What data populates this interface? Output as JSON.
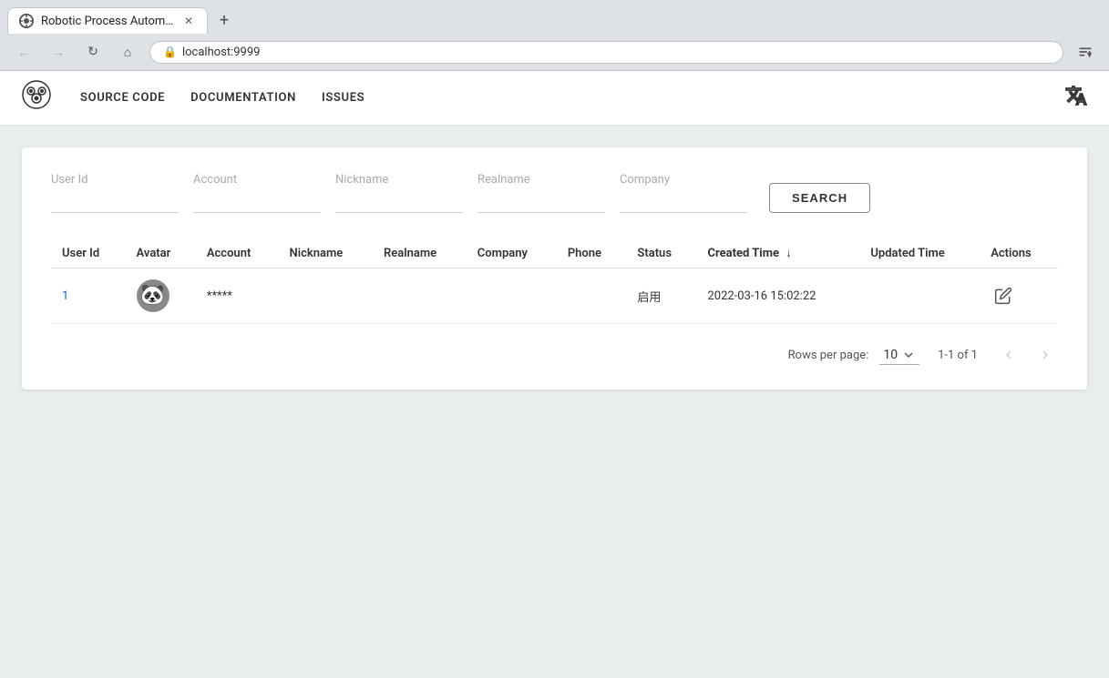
{
  "browser": {
    "tab_title": "Robotic Process Automation T",
    "tab_favicon": "🐙",
    "url": "localhost:9999",
    "new_tab_label": "+"
  },
  "header": {
    "logo": "🤖",
    "nav": [
      {
        "id": "source-code",
        "label": "SOURCE CODE"
      },
      {
        "id": "documentation",
        "label": "DOCUMENTATION"
      },
      {
        "id": "issues",
        "label": "ISSUES"
      }
    ],
    "translate_icon": "translate"
  },
  "search": {
    "fields": [
      {
        "id": "user-id",
        "label": "User Id",
        "placeholder": ""
      },
      {
        "id": "account",
        "label": "Account",
        "placeholder": ""
      },
      {
        "id": "nickname",
        "label": "Nickname",
        "placeholder": ""
      },
      {
        "id": "realname",
        "label": "Realname",
        "placeholder": ""
      },
      {
        "id": "company",
        "label": "Company",
        "placeholder": ""
      }
    ],
    "button_label": "SEARCH"
  },
  "table": {
    "columns": [
      {
        "id": "user-id",
        "label": "User Id",
        "sortable": false
      },
      {
        "id": "avatar",
        "label": "Avatar",
        "sortable": false
      },
      {
        "id": "account",
        "label": "Account",
        "sortable": false
      },
      {
        "id": "nickname",
        "label": "Nickname",
        "sortable": false
      },
      {
        "id": "realname",
        "label": "Realname",
        "sortable": false
      },
      {
        "id": "company",
        "label": "Company",
        "sortable": false
      },
      {
        "id": "phone",
        "label": "Phone",
        "sortable": false
      },
      {
        "id": "status",
        "label": "Status",
        "sortable": false
      },
      {
        "id": "created-time",
        "label": "Created Time",
        "sortable": true,
        "sorted": true,
        "sort_dir": "desc"
      },
      {
        "id": "updated-time",
        "label": "Updated Time",
        "sortable": false
      },
      {
        "id": "actions",
        "label": "Actions",
        "sortable": false
      }
    ],
    "rows": [
      {
        "user_id": "1",
        "avatar_emoji": "🐼",
        "account": "*****",
        "nickname": "",
        "realname": "",
        "company": "",
        "phone": "",
        "status": "启用",
        "created_time": "2022-03-16 15:02:22",
        "updated_time": "",
        "has_action": true
      }
    ]
  },
  "pagination": {
    "rows_per_page_label": "Rows per page:",
    "rows_per_page_value": "10",
    "page_info": "1-1 of 1",
    "prev_disabled": true,
    "next_disabled": true
  }
}
